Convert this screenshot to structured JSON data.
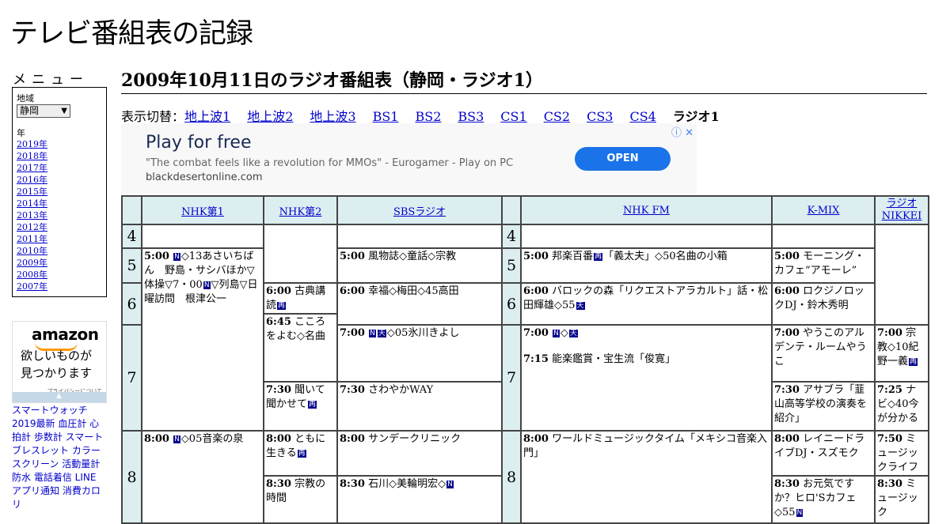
{
  "site": {
    "title": "テレビ番組表の記録"
  },
  "menu": {
    "title": "メニュー",
    "region_label": "地域",
    "region_value": "静岡",
    "year_label": "年",
    "years": [
      "2019年",
      "2018年",
      "2017年",
      "2016年",
      "2015年",
      "2014年",
      "2013年",
      "2012年",
      "2011年",
      "2010年",
      "2009年",
      "2008年",
      "2007年"
    ]
  },
  "amazon": {
    "logo": "amazon",
    "tagline1": "欲しいものが",
    "tagline2": "見つかります",
    "privacy": "プライバシーについて"
  },
  "sidebar_links": "スマートウォッチ 2019最新 血圧計 心拍計 歩数計 スマートブレスレット カラースクリーン 活動量計 防水 電話着信 LINE アプリ通知 消費カロリ",
  "page": {
    "title": "2009年10月11日のラジオ番組表（静岡・ラジオ1）"
  },
  "switcher": {
    "label": "表示切替：",
    "links": [
      "地上波1",
      "地上波2",
      "地上波3",
      "BS1",
      "BS2",
      "BS3",
      "CS1",
      "CS2",
      "CS3",
      "CS4"
    ],
    "current": "ラジオ1"
  },
  "ad": {
    "headline": "Play for free",
    "quote": "\"The combat feels like a revolution for MMOs\" - Eurogamer - Play on PC",
    "domain": "blackdesertonline.com",
    "cta": "OPEN",
    "icons": "ⓘ ✕"
  },
  "schedule": {
    "channels": [
      "NHK第1",
      "NHK第2",
      "SBSラジオ",
      "NHK FM",
      "K-MIX",
      "ラジオNIKKEI"
    ],
    "hours": [
      "4",
      "5",
      "6",
      "7",
      "8"
    ],
    "nhk1": {
      "p500_time": "5:00",
      "p500_title": "◇13あさいちばん　野島・サシバほか▽体操▽7・00",
      "p500_title2": "▽列島▽日曜訪問　根津公一",
      "p800_time": "8:00",
      "p800_title": "◇05音楽の泉"
    },
    "nhk2": {
      "p600_time": "6:00",
      "p600_title": "古典講読",
      "p645_time": "6:45",
      "p645_title": "こころをよむ◇名曲",
      "p730_time": "7:30",
      "p730_title": "聞いて聞かせて",
      "p800_time": "8:00",
      "p800_title": "ともに生きる",
      "p830_time": "8:30",
      "p830_title": "宗教の時間"
    },
    "sbs": {
      "p500_time": "5:00",
      "p500_title": "風物誌◇童話◇宗教",
      "p600_time": "6:00",
      "p600_title": "幸福◇梅田◇45高田",
      "p700_time": "7:00",
      "p700_title": "◇05氷川きよし",
      "p730_time": "7:30",
      "p730_title": "さわやかWAY",
      "p800_time": "8:00",
      "p800_title": "サンデークリニック",
      "p830_time": "8:30",
      "p830_title": "石川◇美輪明宏◇"
    },
    "nhkfm": {
      "p500_time": "5:00",
      "p500_title": "邦楽百番",
      "p500_title2": "「義太夫」◇50名曲の小箱",
      "p600_time": "6:00",
      "p600_title": "バロックの森「リクエストアラカルト」話・松田輝雄◇55",
      "p700_time": "7:00",
      "p700_title": "◇",
      "p715_time": "7:15",
      "p715_title": "能楽鑑賞・宝生流「俊寛」",
      "p800_time": "8:00",
      "p800_title": "ワールドミュージックタイム「メキシコ音楽入門」"
    },
    "kmix": {
      "p500_time": "5:00",
      "p500_title": "モーニング・カフェ“アモーレ”",
      "p600_time": "6:00",
      "p600_title": "ロクジノロックDJ・鈴木秀明",
      "p700_time": "7:00",
      "p700_title": "やうこのアルデンテ・ルームやうこ",
      "p730_time": "7:30",
      "p730_title": "アサブラ「韮山高等学校の演奏を紹介」",
      "p800_time": "8:00",
      "p800_title": "レイニードライブDJ・スズモク",
      "p830_time": "8:30",
      "p830_title": "お元気ですか？ヒロ'Sカフェ◇55"
    },
    "nikkei": {
      "p700_time": "7:00",
      "p700_title": "宗教◇10紀野一義",
      "p725_time": "7:25",
      "p725_title": "ナビ◇40今が分かる",
      "p750_time": "7:50",
      "p750_title": "ミュージックライフ",
      "p830_time": "8:30",
      "p830_title": "ミュージック"
    },
    "glyphs": {
      "n": "N",
      "ten": "天",
      "sai": "再"
    }
  }
}
